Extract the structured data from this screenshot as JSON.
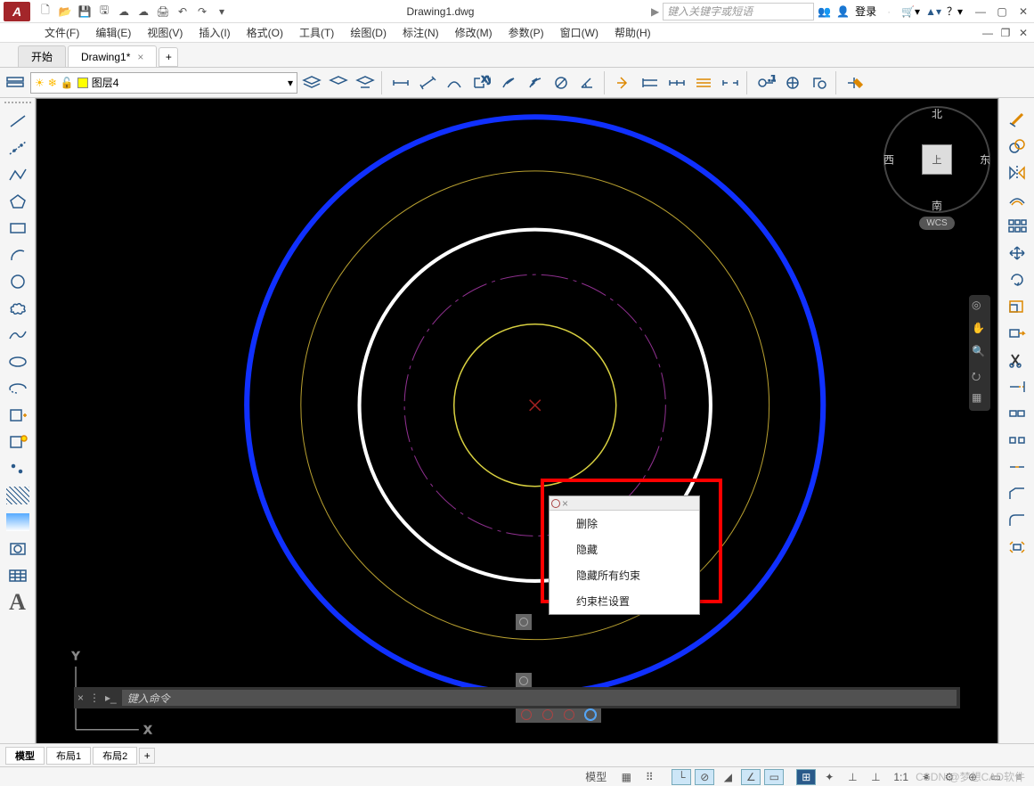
{
  "titlebar": {
    "app_letter": "A",
    "document_title": "Drawing1.dwg",
    "search_placeholder": "键入关键字或短语",
    "login_label": "登录",
    "search_arrow": "▶"
  },
  "menubar": {
    "file": "文件(F)",
    "edit": "编辑(E)",
    "view": "视图(V)",
    "insert": "插入(I)",
    "format": "格式(O)",
    "tools": "工具(T)",
    "draw": "绘图(D)",
    "dimension": "标注(N)",
    "modify": "修改(M)",
    "parametric": "参数(P)",
    "window": "窗口(W)",
    "help": "帮助(H)"
  },
  "tabs": {
    "start": "开始",
    "drawing": "Drawing1*",
    "close": "×",
    "add": "+"
  },
  "layers": {
    "current": "图层4"
  },
  "context_menu": {
    "delete": "删除",
    "hide": "隐藏",
    "hide_all": "隐藏所有约束",
    "settings": "约束栏设置"
  },
  "viewcube": {
    "north": "北",
    "south": "南",
    "east": "东",
    "west": "西",
    "top": "上",
    "wcs": "WCS"
  },
  "commandline": {
    "placeholder": "键入命令"
  },
  "layout_tabs": {
    "model": "模型",
    "layout1": "布局1",
    "layout2": "布局2",
    "add": "+"
  },
  "statusbar": {
    "model": "模型",
    "scale": "1:1"
  },
  "watermark": "CSDN @梦想CAD软件",
  "bottom_a": "A",
  "axis": {
    "x": "X",
    "y": "Y"
  }
}
